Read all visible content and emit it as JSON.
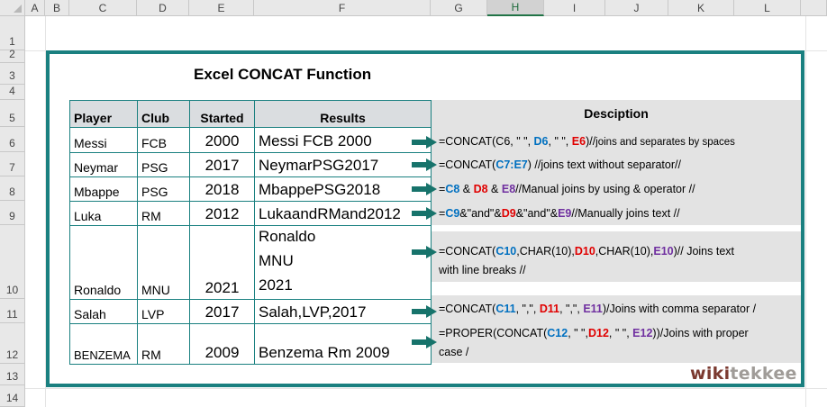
{
  "columns": [
    "A",
    "B",
    "C",
    "D",
    "E",
    "F",
    "G",
    "H",
    "I",
    "J",
    "K",
    "L"
  ],
  "selected_column": "H",
  "rows": [
    "1",
    "2",
    "3",
    "4",
    "5",
    "6",
    "7",
    "8",
    "9",
    "10",
    "11",
    "12",
    "13",
    "14"
  ],
  "title": "Excel CONCAT Function",
  "table": {
    "headers": [
      "Player",
      "Club",
      "Started",
      "Results"
    ],
    "rows": [
      {
        "player": "Messi",
        "club": "FCB",
        "started": "2000",
        "result": "Messi FCB 2000"
      },
      {
        "player": "Neymar",
        "club": "PSG",
        "started": "2017",
        "result": "NeymarPSG2017"
      },
      {
        "player": "Mbappe",
        "club": "PSG",
        "started": "2018",
        "result": "MbappePSG2018"
      },
      {
        "player": "Luka",
        "club": "RM",
        "started": "2012",
        "result": "LukaandRMand2012"
      },
      {
        "player": "Ronaldo",
        "club": "MNU",
        "started": "2021",
        "result_lines": [
          "Ronaldo",
          "MNU",
          "2021"
        ]
      },
      {
        "player": "Salah",
        "club": "LVP",
        "started": "2017",
        "result": "Salah,LVP,2017"
      },
      {
        "player": "BENZEMA",
        "club": "RM",
        "started": "2009",
        "result": "Benzema Rm 2009"
      }
    ]
  },
  "description": {
    "header": "Desciption",
    "d6": {
      "p1": "=CONCAT(C6, \" \", ",
      "ref1": "D6",
      "p2": ", \" \", ",
      "ref2": "E6",
      "p3": ")//",
      "comment": "joins and separates by spaces"
    },
    "d7": {
      "p1": "=CONCAT(",
      "ref1": "C7:E7",
      "p2": ") //joins text without separator//"
    },
    "d8": {
      "p1": "=",
      "ref1": "C8",
      "p2": " & ",
      "ref2": "D8",
      "p3": " & ",
      "ref3": "E8",
      "p4": "//Manual joins by using & operator //"
    },
    "d9": {
      "p1": "=",
      "ref1": "C9",
      "p2": "&\"and\"&",
      "ref2": "D9",
      "p3": "&\"and\"&",
      "ref3": "E9",
      "p4": "//Manually joins text //"
    },
    "d10": {
      "p1": "=CONCAT(",
      "ref1": "C10",
      "p2": ",CHAR(10),",
      "ref2": "D10",
      "p3": ",CHAR(10),",
      "ref3": "E10",
      "p4": ")// Joins text",
      "line2": "with line breaks //"
    },
    "d11": {
      "p1": "=CONCAT(",
      "ref1": "C11",
      "p2": ", \",\", ",
      "ref2": "D11",
      "p3": ", \",\", ",
      "ref3": "E11",
      "p4": ")/Joins with comma separator /"
    },
    "d12": {
      "p1": "=PROPER(CONCAT(",
      "ref1": "C12",
      "p2": ", \" \",",
      "ref2": "D12",
      "p3": ", \" \", ",
      "ref3": "E12",
      "p4": "))/Joins with proper",
      "line2": "case /"
    }
  },
  "logo": {
    "part1": "wiki",
    "part2": "tekkee"
  },
  "colors": {
    "frame": "#1a8080",
    "ref_blue": "#0070c0",
    "ref_red": "#e00000",
    "ref_purple": "#7030a0",
    "arrow": "#17736b",
    "panel": "#e3e3e3"
  }
}
